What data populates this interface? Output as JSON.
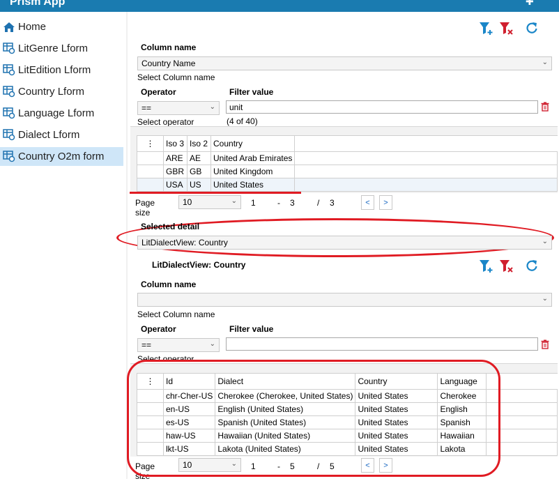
{
  "app": {
    "title": "Prism App",
    "settings_icon": "gear-icon"
  },
  "sidebar": {
    "items": [
      {
        "label": "Home",
        "icon": "home-icon",
        "selected": false
      },
      {
        "label": "LitGenre Lform",
        "icon": "table-refresh-icon",
        "selected": false
      },
      {
        "label": "LitEdition Lform",
        "icon": "table-refresh-icon",
        "selected": false
      },
      {
        "label": "Country Lform",
        "icon": "table-refresh-icon",
        "selected": false
      },
      {
        "label": "Language Lform",
        "icon": "table-refresh-icon",
        "selected": false
      },
      {
        "label": "Dialect Lform",
        "icon": "table-refresh-icon",
        "selected": false
      },
      {
        "label": "Country O2m form",
        "icon": "table-refresh-icon",
        "selected": true
      }
    ]
  },
  "master": {
    "column_name_label": "Column name",
    "column_name_value": "Country Name",
    "column_name_hint": "Select Column name",
    "operator_label": "Operator",
    "operator_value": "==",
    "operator_hint": "Select operator",
    "filter_value_label": "Filter value",
    "filter_value": "unit",
    "filter_count": "(4 of 40)",
    "grid": {
      "columns": [
        "⋮",
        "Iso 3",
        "Iso 2",
        "Country"
      ],
      "rows": [
        [
          "",
          "ARE",
          "AE",
          "United Arab Emirates"
        ],
        [
          "",
          "GBR",
          "GB",
          "United Kingdom"
        ],
        [
          "",
          "USA",
          "US",
          "United States"
        ]
      ]
    },
    "pager": {
      "label": "Page size",
      "size": "10",
      "from": "1",
      "dash": "-",
      "to": "3",
      "slash": "/",
      "total": "3",
      "prev": "<",
      "next": ">"
    }
  },
  "selected_detail": {
    "label": "Selected detail",
    "value": "LitDialectView: Country"
  },
  "detail": {
    "title": "LitDialectView: Country",
    "column_name_label": "Column name",
    "column_name_value": "",
    "column_name_hint": "Select Column name",
    "operator_label": "Operator",
    "operator_value": "==",
    "operator_hint": "Select operator",
    "filter_value_label": "Filter value",
    "filter_value": "",
    "grid": {
      "columns": [
        "⋮",
        "Id",
        "Dialect",
        "Country",
        "Language"
      ],
      "rows": [
        [
          "",
          "chr-Cher-US",
          "Cherokee (Cherokee, United States)",
          "United States",
          "Cherokee"
        ],
        [
          "",
          "en-US",
          "English (United States)",
          "United States",
          "English"
        ],
        [
          "",
          "es-US",
          "Spanish (United States)",
          "United States",
          "Spanish"
        ],
        [
          "",
          "haw-US",
          "Hawaiian (United States)",
          "United States",
          "Hawaiian"
        ],
        [
          "",
          "lkt-US",
          "Lakota (United States)",
          "United States",
          "Lakota"
        ]
      ]
    },
    "pager": {
      "label": "Page size",
      "size": "10",
      "from": "1",
      "dash": "-",
      "to": "5",
      "slash": "/",
      "total": "5",
      "prev": "<",
      "next": ">"
    }
  },
  "toolbar": {
    "add_filter_icon": "filter-add-icon",
    "clear_filter_icon": "filter-clear-icon",
    "refresh_icon": "refresh-icon",
    "delete_icon": "trash-icon"
  },
  "colors": {
    "accent": "#1a7bb0",
    "selection": "#cfe6f8",
    "annotation_red": "#e01b23",
    "filter_blue": "#1a86c8",
    "filter_red": "#d0202f"
  }
}
